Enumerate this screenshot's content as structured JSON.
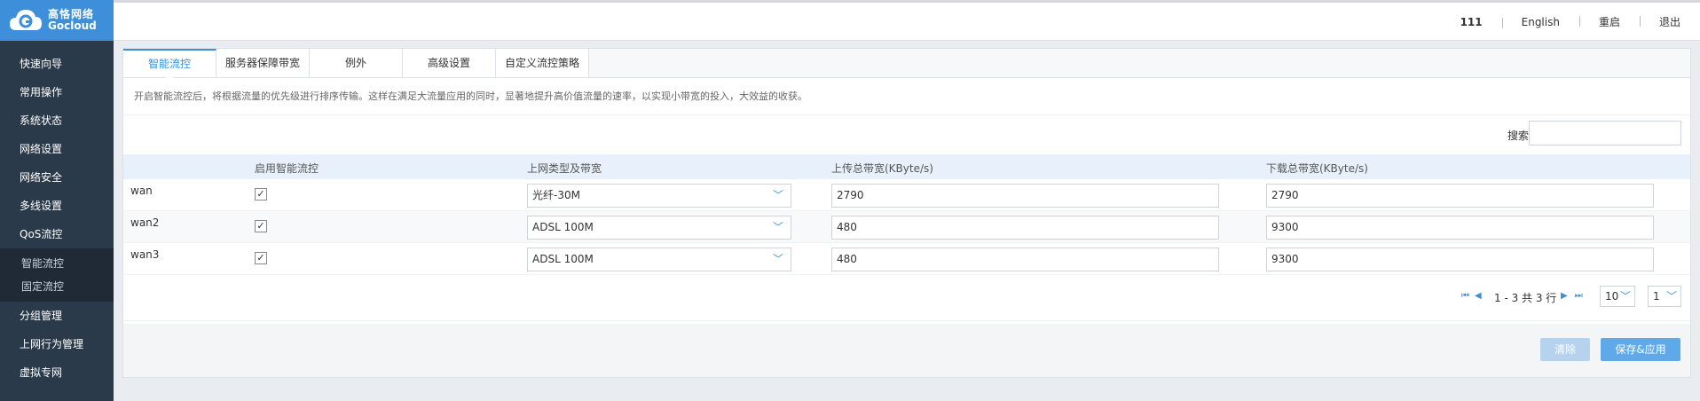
{
  "brand": {
    "name_cn": "高恪网络",
    "name_en": "Gocloud"
  },
  "header": {
    "user": "111",
    "language": "English",
    "reboot": "重启",
    "logout": "退出"
  },
  "sidebar": {
    "items": [
      {
        "label": "快速向导"
      },
      {
        "label": "常用操作"
      },
      {
        "label": "系统状态"
      },
      {
        "label": "网络设置"
      },
      {
        "label": "网络安全"
      },
      {
        "label": "多线设置"
      },
      {
        "label": "QoS流控"
      }
    ],
    "sub_items": [
      {
        "label": "智能流控"
      },
      {
        "label": "固定流控"
      }
    ],
    "items_after": [
      {
        "label": "分组管理"
      },
      {
        "label": "上网行为管理"
      },
      {
        "label": "虚拟专网"
      }
    ]
  },
  "tabs": [
    {
      "label": "智能流控"
    },
    {
      "label": "服务器保障带宽"
    },
    {
      "label": "例外"
    },
    {
      "label": "高级设置"
    },
    {
      "label": "自定义流控策略"
    }
  ],
  "description": "开启智能流控后，将根据流量的优先级进行排序传输。这样在满足大流量应用的同时，显著地提升高价值流量的速率，以实现小带宽的投入，大效益的收获。",
  "search": {
    "label": "搜索:",
    "value": ""
  },
  "table": {
    "columns": [
      "启用智能流控",
      "上网类型及带宽",
      "上传总带宽(KByte/s)",
      "下载总带宽(KByte/s)"
    ],
    "rows": [
      {
        "name": "wan",
        "enabled": true,
        "type": "光纤-30M",
        "upload": "2790",
        "download": "2790"
      },
      {
        "name": "wan2",
        "enabled": true,
        "type": "ADSL 100M",
        "upload": "480",
        "download": "9300"
      },
      {
        "name": "wan3",
        "enabled": true,
        "type": "ADSL 100M",
        "upload": "480",
        "download": "9300"
      }
    ]
  },
  "pager": {
    "info": "1 - 3 共 3 行",
    "page_size": "10",
    "page": "1"
  },
  "buttons": {
    "clear": "清除",
    "save": "保存&应用"
  },
  "colors": {
    "accent": "#3c8fd8",
    "sidebar": "#2b3a4a"
  }
}
